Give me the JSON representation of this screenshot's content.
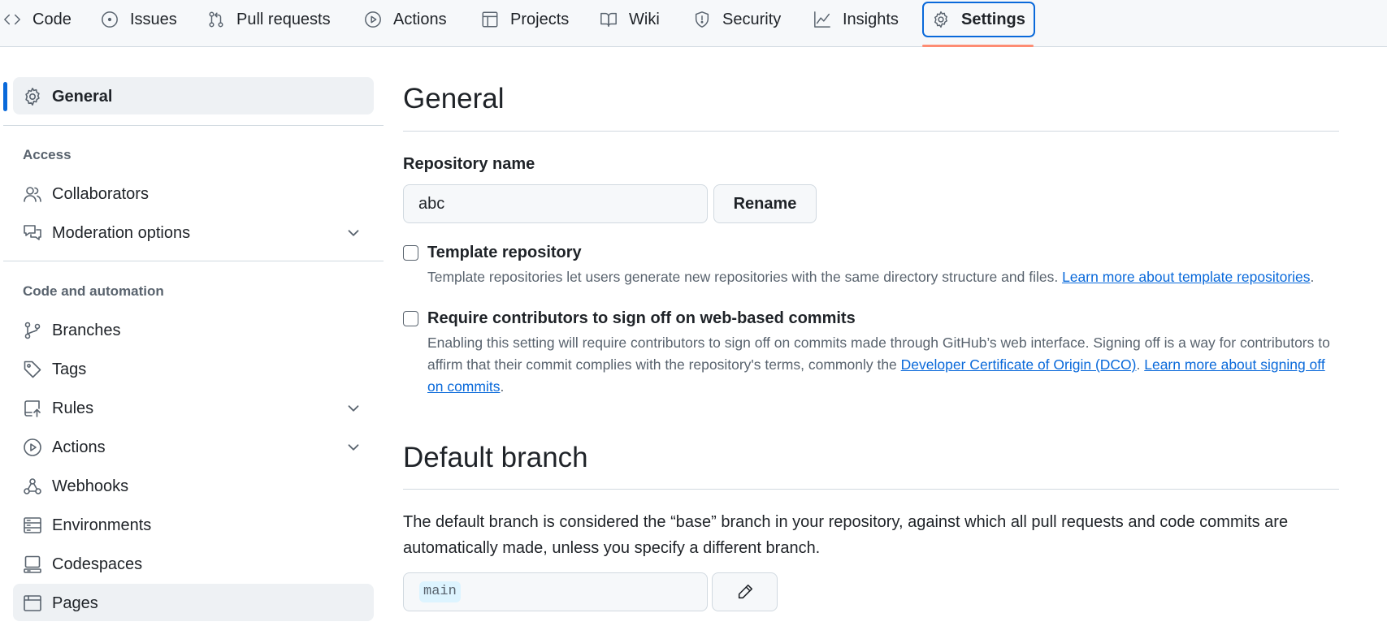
{
  "tabs": [
    {
      "label": "Code",
      "icon": "code-icon"
    },
    {
      "label": "Issues",
      "icon": "issue-opened-icon"
    },
    {
      "label": "Pull requests",
      "icon": "git-pull-request-icon"
    },
    {
      "label": "Actions",
      "icon": "play-icon"
    },
    {
      "label": "Projects",
      "icon": "table-icon"
    },
    {
      "label": "Wiki",
      "icon": "book-icon"
    },
    {
      "label": "Security",
      "icon": "shield-icon"
    },
    {
      "label": "Insights",
      "icon": "graph-icon"
    },
    {
      "label": "Settings",
      "icon": "gear-icon",
      "selected": true
    }
  ],
  "sidebar": {
    "general": {
      "label": "General",
      "icon": "gear-icon"
    },
    "access": {
      "heading": "Access",
      "items": [
        {
          "label": "Collaborators",
          "icon": "people-icon"
        },
        {
          "label": "Moderation options",
          "icon": "comment-discussion-icon",
          "expandable": true
        }
      ]
    },
    "code_automation": {
      "heading": "Code and automation",
      "items": [
        {
          "label": "Branches",
          "icon": "git-branch-icon"
        },
        {
          "label": "Tags",
          "icon": "tag-icon"
        },
        {
          "label": "Rules",
          "icon": "repo-push-icon",
          "expandable": true
        },
        {
          "label": "Actions",
          "icon": "play-icon",
          "expandable": true
        },
        {
          "label": "Webhooks",
          "icon": "webhook-icon"
        },
        {
          "label": "Environments",
          "icon": "server-icon"
        },
        {
          "label": "Codespaces",
          "icon": "codespaces-icon"
        },
        {
          "label": "Pages",
          "icon": "browser-icon"
        }
      ]
    }
  },
  "main": {
    "title": "General",
    "repo_name_label": "Repository name",
    "repo_name_value": "abc",
    "rename_label": "Rename",
    "template": {
      "title": "Template repository",
      "desc": "Template repositories let users generate new repositories with the same directory structure and files.",
      "link": "Learn more about template repositories",
      "end": "."
    },
    "signoff": {
      "title": "Require contributors to sign off on web-based commits",
      "desc": "Enabling this setting will require contributors to sign off on commits made through GitHub’s web interface. Signing off is a way for contributors to affirm that their commit complies with the repository's terms, commonly the",
      "link1": "Developer Certificate of Origin (DCO)",
      "mid": ".",
      "link2": "Learn more about signing off on commits",
      "end": "."
    },
    "default_branch": {
      "title": "Default branch",
      "desc": "The default branch is considered the “base” branch in your repository, against which all pull requests and code commits are automatically made, unless you specify a different branch.",
      "branch": "main",
      "edit_icon": "pencil-icon"
    }
  }
}
